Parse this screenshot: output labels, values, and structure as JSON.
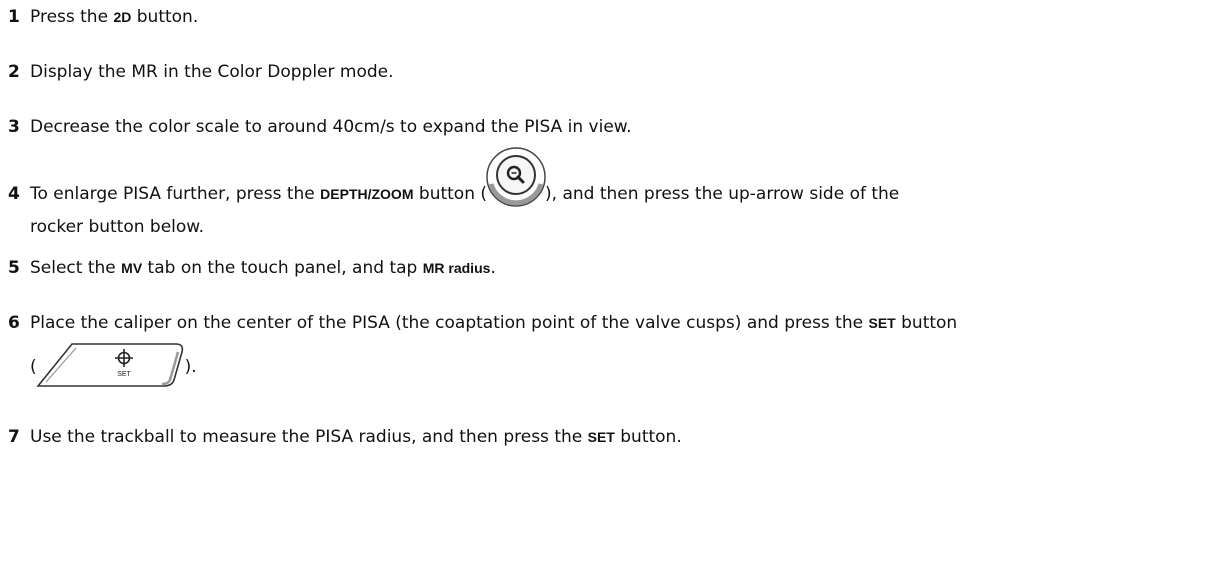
{
  "steps": [
    {
      "num": "1",
      "pre": "Press the ",
      "kw": "2D",
      "post": " button."
    },
    {
      "num": "2",
      "text": "Display the MR in the Color Doppler mode."
    },
    {
      "num": "3",
      "text": "Decrease the color scale to around 40cm/s to expand the PISA in view."
    },
    {
      "num": "4",
      "pre": "To enlarge PISA further, press the ",
      "kw": "DEPTH/ZOOM",
      "mid": " button (",
      "post": "), and then press the up-arrow side of the",
      "cont": "rocker button below.",
      "icon": "zoom-dial-icon"
    },
    {
      "num": "5",
      "pre": "Select the ",
      "kw": "MV",
      "mid": " tab on the touch panel, and tap ",
      "kw2": "MR radius",
      "post": "."
    },
    {
      "num": "6",
      "pre": "Place the caliper on the center of the PISA (the coaptation point of the valve cusps) and press the ",
      "kw": "SET",
      "post": " button",
      "l2pre": "(",
      "l2post": ").",
      "icon": "set-button-icon",
      "icon_label": "SET"
    },
    {
      "num": "7",
      "pre": "Use the trackball to measure the PISA radius, and then press the ",
      "kw": "SET",
      "post": " button."
    }
  ]
}
